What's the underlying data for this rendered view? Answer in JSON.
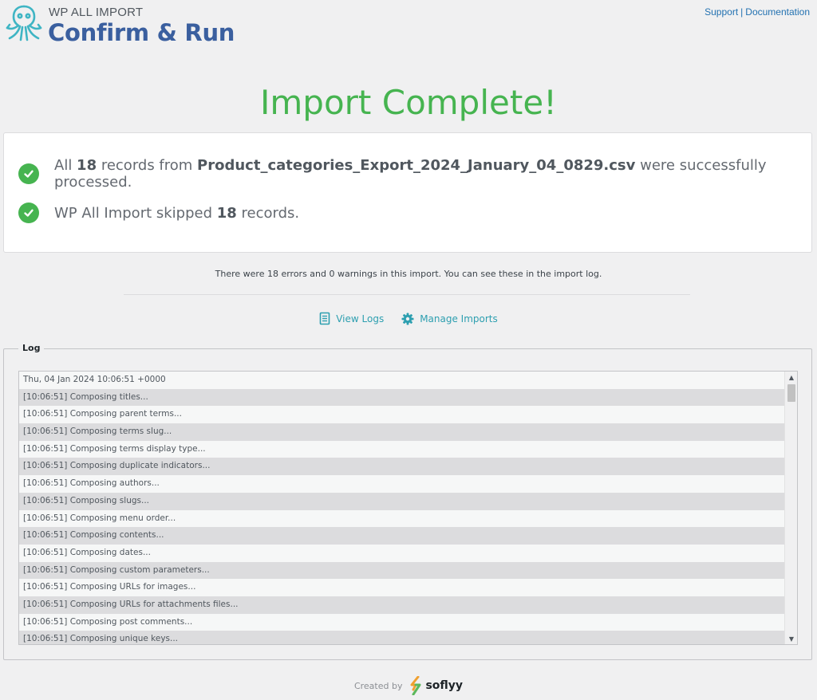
{
  "header": {
    "brand_small": "WP ALL IMPORT",
    "title": "Confirm & Run",
    "links": {
      "support": "Support",
      "separator": "|",
      "documentation": "Documentation"
    }
  },
  "headline": "Import Complete!",
  "summary": {
    "line1": {
      "prefix": "All ",
      "count": "18",
      "middle": " records from ",
      "filename": "Product_categories_Export_2024_January_04_0829.csv",
      "suffix": " were successfully processed."
    },
    "line2": {
      "prefix": "WP All Import skipped ",
      "count": "18",
      "suffix": " records."
    }
  },
  "notice": "There were 18 errors and 0 warnings in this import. You can see these in the import log.",
  "actions": {
    "view_logs": "View Logs",
    "manage_imports": "Manage Imports"
  },
  "log": {
    "legend": "Log",
    "rows": [
      "Thu, 04 Jan 2024 10:06:51 +0000",
      "[10:06:51] Composing titles...",
      "[10:06:51] Composing parent terms...",
      "[10:06:51] Composing terms slug...",
      "[10:06:51] Composing terms display type...",
      "[10:06:51] Composing duplicate indicators...",
      "[10:06:51] Composing authors...",
      "[10:06:51] Composing slugs...",
      "[10:06:51] Composing menu order...",
      "[10:06:51] Composing contents...",
      "[10:06:51] Composing dates...",
      "[10:06:51] Composing custom parameters...",
      "[10:06:51] Composing URLs for images...",
      "[10:06:51] Composing URLs for attachments files...",
      "[10:06:51] Composing post comments...",
      "[10:06:51] Composing unique keys..."
    ]
  },
  "footer": {
    "created_by": "Created by",
    "company": "soflyy"
  },
  "colors": {
    "success": "#46b450",
    "brand_blue": "#3a5f9f",
    "link": "#2271b1",
    "action_teal": "#2d9fb0",
    "logo_teal": "#3fb5c4"
  }
}
